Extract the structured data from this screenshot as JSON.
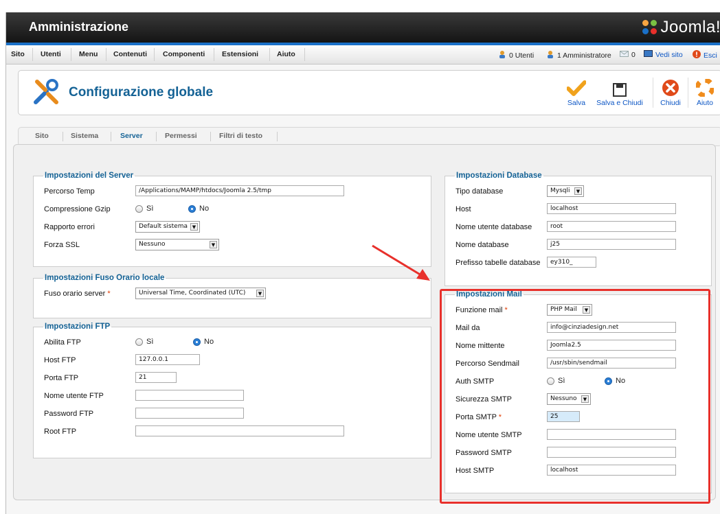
{
  "header": {
    "title": "Amministrazione",
    "logo_text": "Joomla!"
  },
  "menu": {
    "items": [
      "Sito",
      "Utenti",
      "Menu",
      "Contenuti",
      "Componenti",
      "Estensioni",
      "Aiuto"
    ]
  },
  "status": {
    "users": "0 Utenti",
    "admins": "1 Amministratore",
    "messages": "0",
    "view_site": "Vedi sito",
    "logout": "Esci"
  },
  "toolbar": {
    "page_title": "Configurazione globale",
    "save": "Salva",
    "save_close": "Salva e Chiudi",
    "close": "Chiudi",
    "help": "Aiuto"
  },
  "tabs": [
    "Sito",
    "Sistema",
    "Server",
    "Permessi",
    "Filtri di testo"
  ],
  "server": {
    "legend": "Impostazioni del Server",
    "temp_label": "Percorso Temp",
    "temp_value": "/Applications/MAMP/htdocs/Joomla 2.5/tmp",
    "gzip_label": "Compressione Gzip",
    "yes": "Sì",
    "no": "No",
    "errors_label": "Rapporto errori",
    "errors_value": "Default sistema",
    "ssl_label": "Forza SSL",
    "ssl_value": "Nessuno"
  },
  "timezone": {
    "legend": "Impostazioni Fuso Orario locale",
    "label": "Fuso orario server",
    "value": "Universal Time, Coordinated (UTC)"
  },
  "ftp": {
    "legend": "Impostazioni FTP",
    "enable_label": "Abilita FTP",
    "host_label": "Host FTP",
    "host_value": "127.0.0.1",
    "port_label": "Porta FTP",
    "port_value": "21",
    "user_label": "Nome utente FTP",
    "user_value": "",
    "pass_label": "Password FTP",
    "pass_value": "",
    "root_label": "Root FTP",
    "root_value": ""
  },
  "database": {
    "legend": "Impostazioni Database",
    "type_label": "Tipo database",
    "type_value": "Mysqli",
    "host_label": "Host",
    "host_value": "localhost",
    "user_label": "Nome utente database",
    "user_value": "root",
    "name_label": "Nome database",
    "name_value": "j25",
    "prefix_label": "Prefisso tabelle database",
    "prefix_value": "ey310_"
  },
  "mail": {
    "legend": "Impostazioni Mail",
    "function_label": "Funzione mail",
    "function_value": "PHP Mail",
    "from_label": "Mail da",
    "from_value": "info@cinziadesign.net",
    "sender_label": "Nome mittente",
    "sender_value": "Joomla2.5",
    "sendmail_label": "Percorso Sendmail",
    "sendmail_value": "/usr/sbin/sendmail",
    "auth_label": "Auth SMTP",
    "security_label": "Sicurezza SMTP",
    "security_value": "Nessuno",
    "port_label": "Porta SMTP",
    "port_value": "25",
    "smtp_user_label": "Nome utente SMTP",
    "smtp_user_value": "",
    "smtp_pass_label": "Password SMTP",
    "smtp_pass_value": "",
    "smtp_host_label": "Host SMTP",
    "smtp_host_value": "localhost"
  },
  "required_mark": "*",
  "colors": {
    "accent": "#146295",
    "highlight": "#e8302b",
    "header": "#1a1a1a",
    "blue_bar": "#1a70c8"
  }
}
